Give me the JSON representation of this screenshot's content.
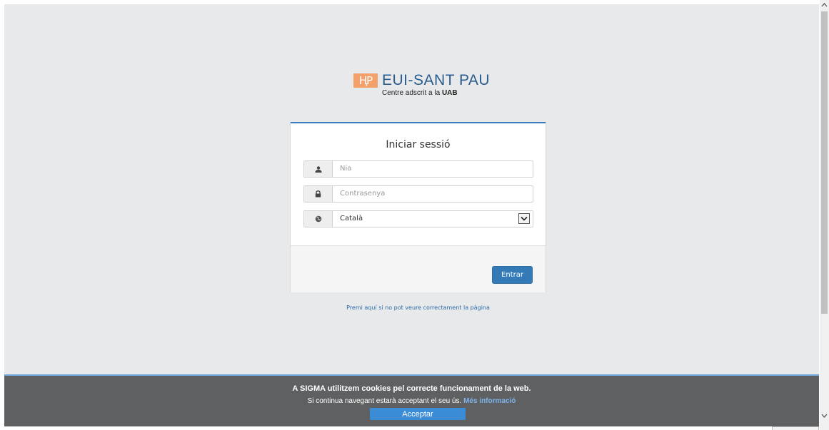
{
  "logo": {
    "mark": "ⱧP",
    "title_strong": "EUI",
    "title_rest": "-SANT PAU",
    "subtitle_prefix": "Centre adscrit a la ",
    "subtitle_strong": "UAB"
  },
  "login": {
    "title": "Iniciar sessió",
    "user_placeholder": "Nia",
    "password_placeholder": "Contrasenya",
    "language_value": "Català",
    "submit_label": "Entrar"
  },
  "help_link": "Premi aquí si no pot veure correctament la pàgina",
  "cookie": {
    "line1": "A SIGMA utilitzem cookies pel correcte funcionament de la web.",
    "line2": "Si continua navegant estarà acceptant el seu ús.",
    "more_link": "Més informació",
    "accept_label": "Acceptar"
  },
  "colors": {
    "accent": "#337ab7",
    "logo_orange": "#f4a06b",
    "cookie_bar": "#5e6061"
  },
  "icons": {
    "user": "user-icon",
    "password": "lock-icon",
    "language": "globe-icon",
    "select": "chevron-down-icon"
  }
}
